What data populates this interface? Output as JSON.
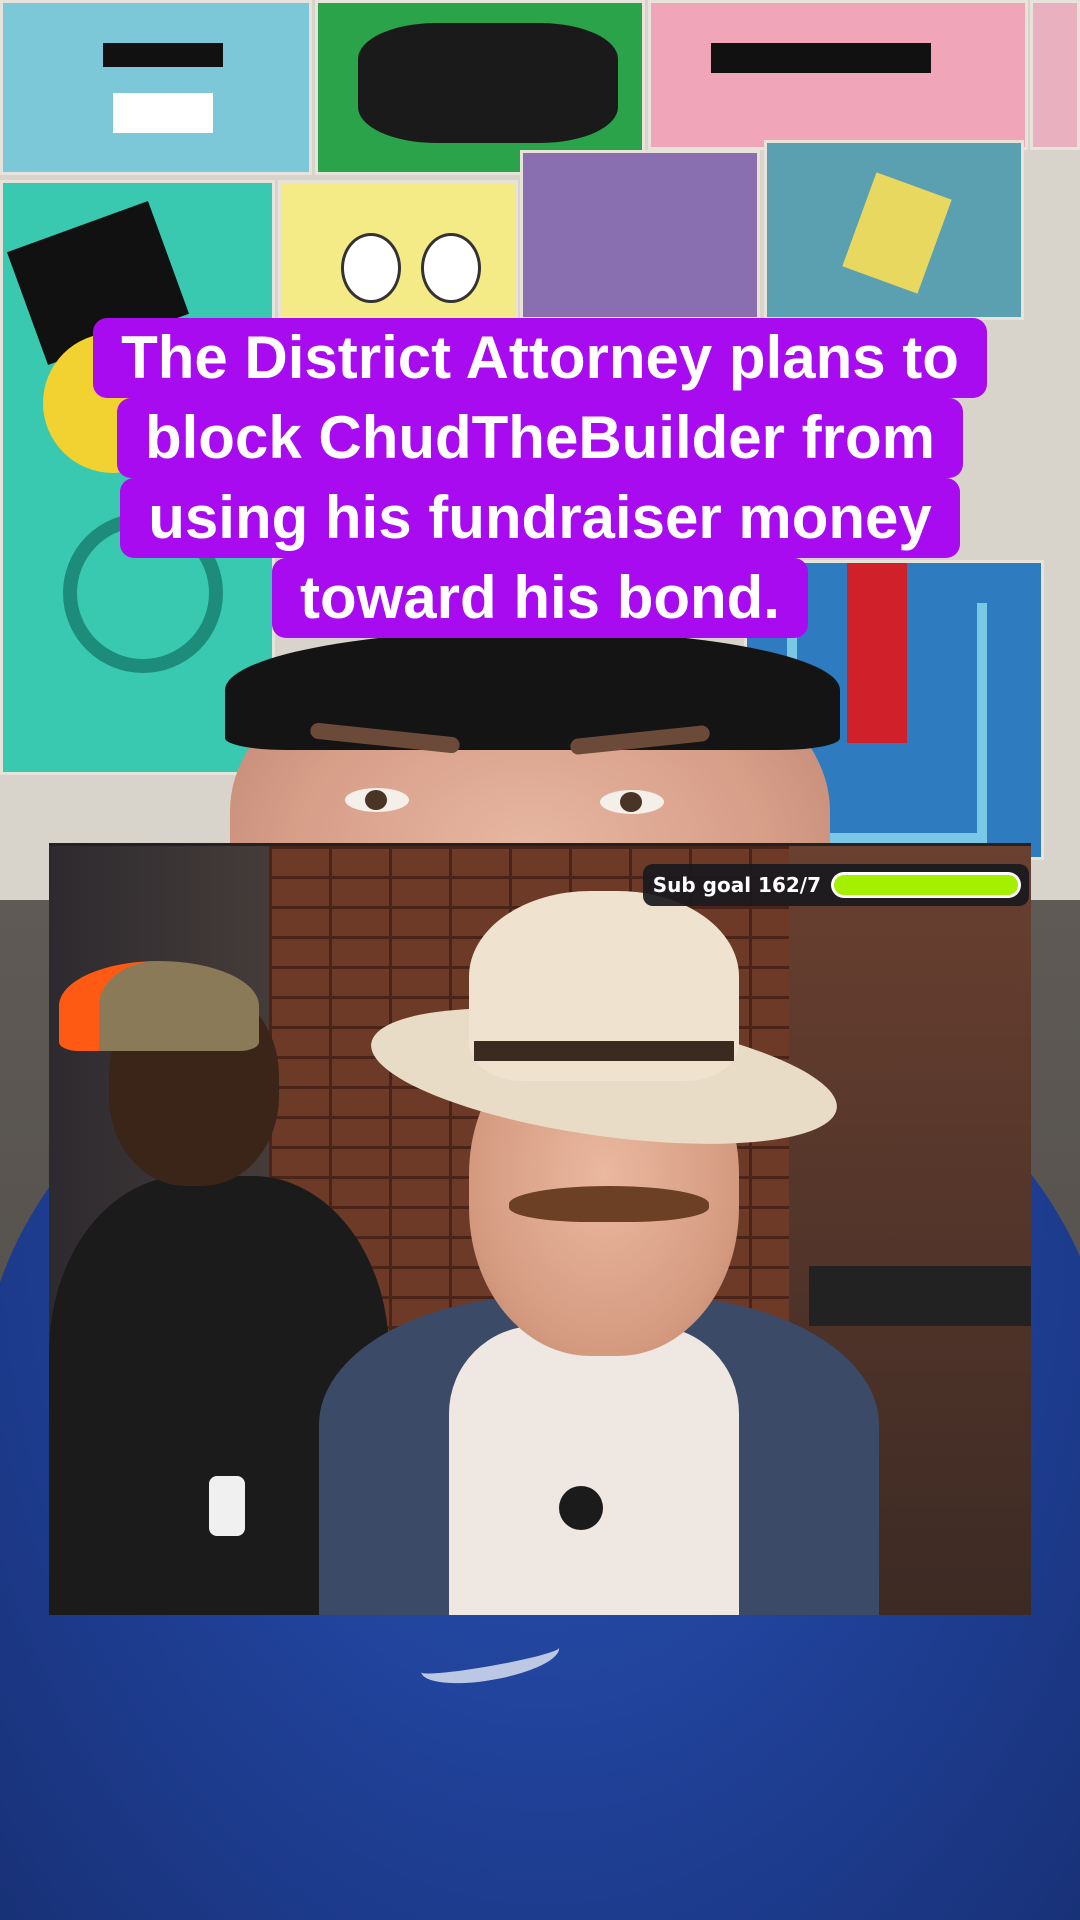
{
  "caption": {
    "lines": [
      "The District Attorney plans to",
      "block ChudTheBuilder from",
      "using his fundraiser money",
      "toward his bond."
    ],
    "background_color": "#a80bf0",
    "text_color": "#ffffff"
  },
  "stream_overlay": {
    "sub_goal_label": "Sub goal 162/7",
    "progress_fraction": 1.0,
    "progress_color": "#a4f000"
  }
}
